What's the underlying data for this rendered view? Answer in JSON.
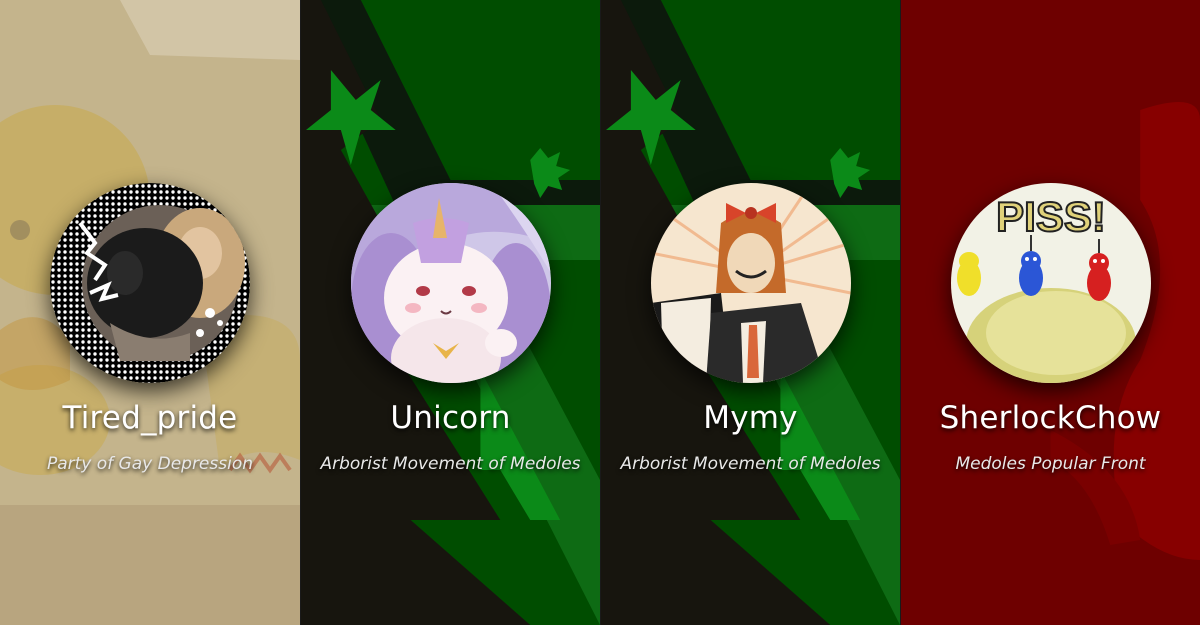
{
  "cards": [
    {
      "name": "Tired_pride",
      "party": "Party of Gay Depression",
      "theme": "pale-yellow",
      "accent": "#c9b98a",
      "avatar_icon": "cat-and-doll-photo"
    },
    {
      "name": "Unicorn",
      "party": "Arborist Movement of Medoles",
      "theme": "green",
      "accent": "#0e6b14",
      "avatar_icon": "unicorn-cartoon"
    },
    {
      "name": "Mymy",
      "party": "Arborist Movement of Medoles",
      "theme": "green",
      "accent": "#0e6b14",
      "avatar_icon": "man-with-bow-drawing"
    },
    {
      "name": "SherlockChow",
      "party": "Medoles Popular Front",
      "theme": "red",
      "accent": "#7a0000",
      "avatar_icon": "pikmin-meme"
    }
  ],
  "avatar_text": {
    "card_4": "PISS!"
  }
}
